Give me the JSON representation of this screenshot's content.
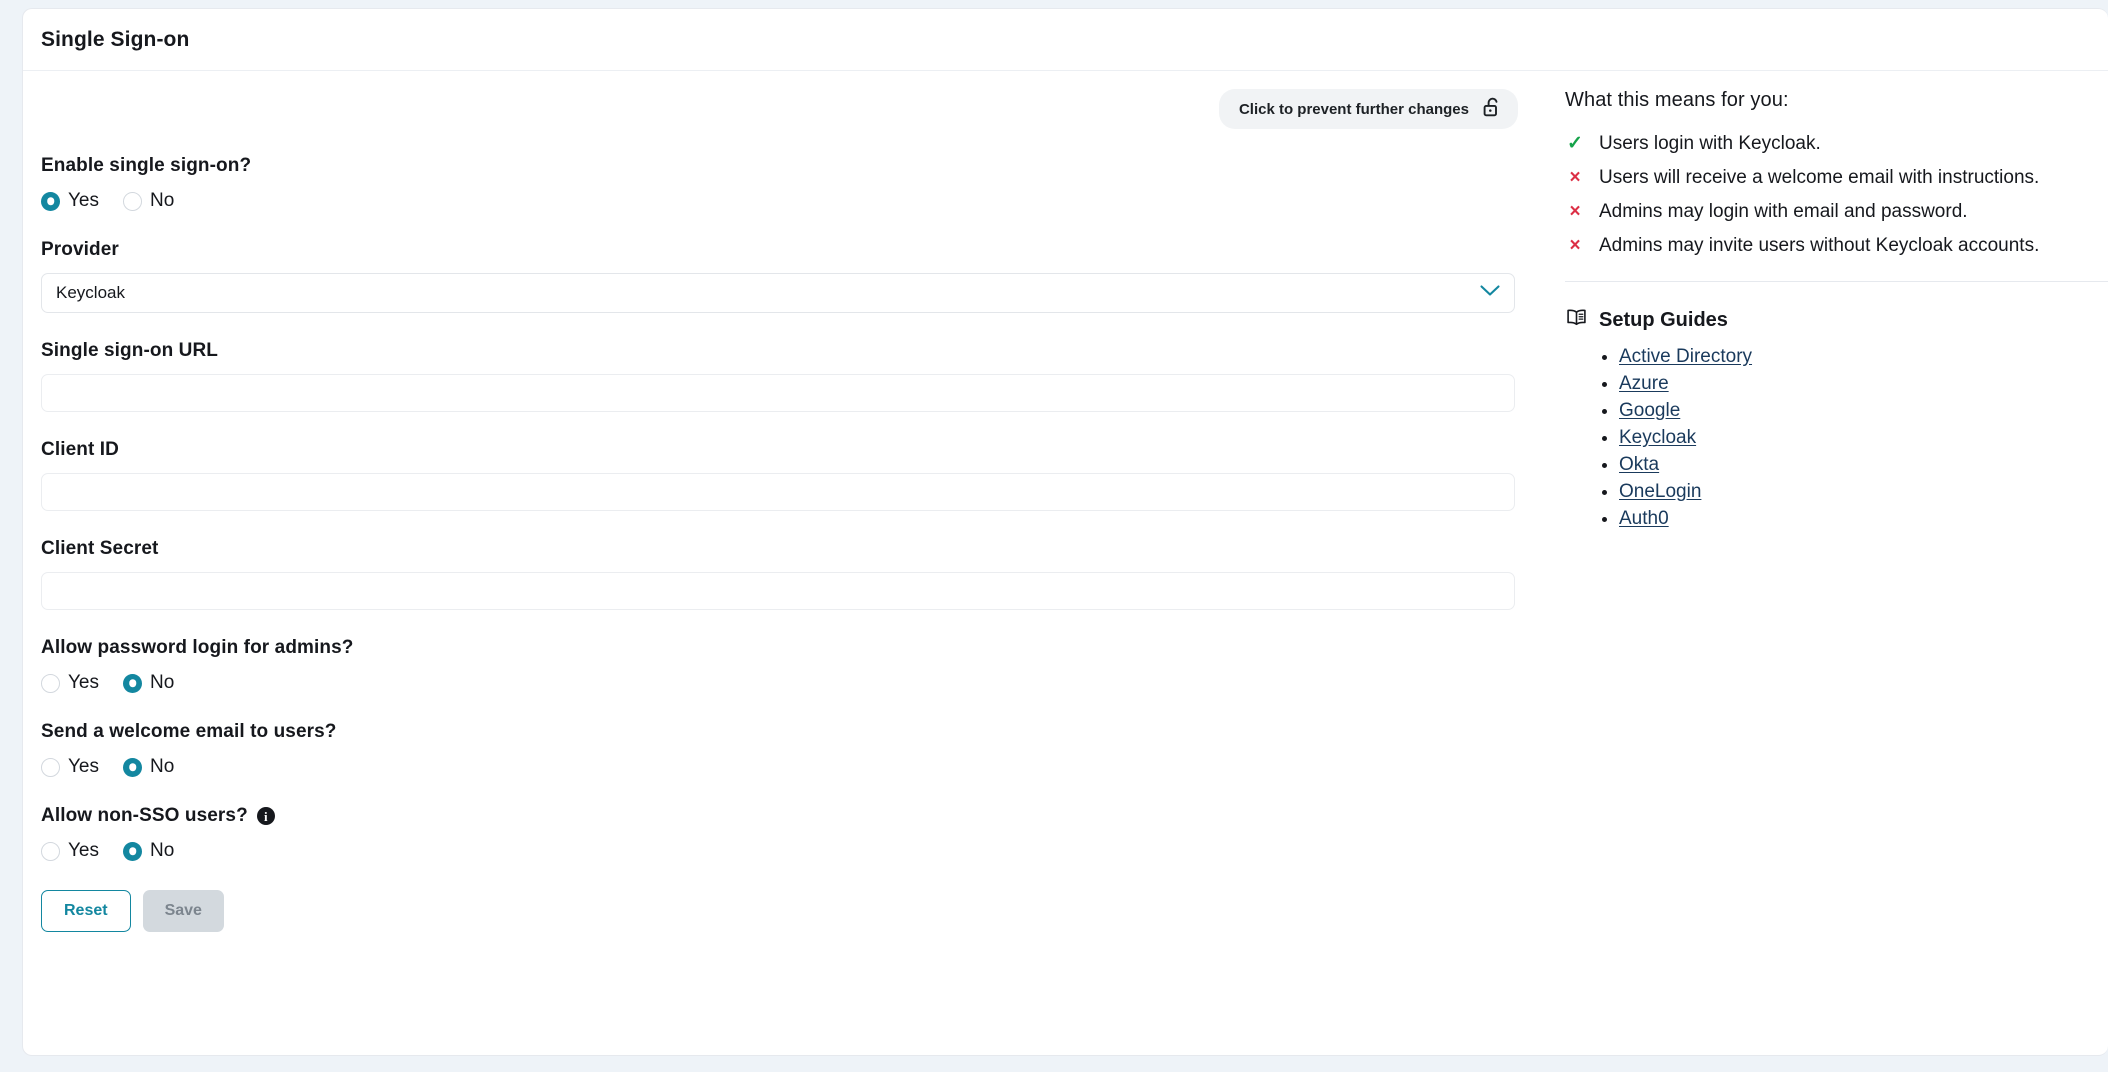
{
  "card": {
    "title": "Single Sign-on"
  },
  "lock_button": {
    "label": "Click to prevent further changes",
    "icon": "unlocked-padlock-icon"
  },
  "form": {
    "enable_sso": {
      "label": "Enable single sign-on?",
      "options": [
        "Yes",
        "No"
      ],
      "selected": "Yes"
    },
    "provider": {
      "label": "Provider",
      "value": "Keycloak",
      "chevron_icon": "chevron-down-icon",
      "chevron_color": "#1387a0"
    },
    "sso_url": {
      "label": "Single sign-on URL",
      "value": "",
      "placeholder": ""
    },
    "client_id": {
      "label": "Client ID",
      "value": "",
      "placeholder": ""
    },
    "client_secret": {
      "label": "Client Secret",
      "value": "",
      "placeholder": ""
    },
    "allow_password_login": {
      "label": "Allow password login for admins?",
      "options": [
        "Yes",
        "No"
      ],
      "selected": "No"
    },
    "send_welcome_email": {
      "label": "Send a welcome email to users?",
      "options": [
        "Yes",
        "No"
      ],
      "selected": "No"
    },
    "allow_non_sso": {
      "label": "Allow non-SSO users?",
      "info_icon": "info-icon",
      "options": [
        "Yes",
        "No"
      ],
      "selected": "No"
    }
  },
  "actions": {
    "reset_label": "Reset",
    "save_label": "Save"
  },
  "sidebar": {
    "means_heading": "What this means for you:",
    "means_items": [
      {
        "mark": "✓",
        "state": "yes",
        "text": "Users login with Keycloak."
      },
      {
        "mark": "×",
        "state": "no",
        "text": "Users will receive a welcome email with instructions."
      },
      {
        "mark": "×",
        "state": "no",
        "text": "Admins may login with email and password."
      },
      {
        "mark": "×",
        "state": "no",
        "text": "Admins may invite users without Keycloak accounts."
      }
    ],
    "guides_title": "Setup Guides",
    "guides_icon": "open-book-icon",
    "guides": [
      "Active Directory",
      "Azure",
      "Google",
      "Keycloak",
      "Okta",
      "OneLogin",
      "Auth0"
    ]
  },
  "colors": {
    "accent": "#1387a0",
    "success": "#16a34a",
    "danger": "#dc2f45",
    "page_background": "#eef3f8",
    "link": "#1a3a5c"
  }
}
